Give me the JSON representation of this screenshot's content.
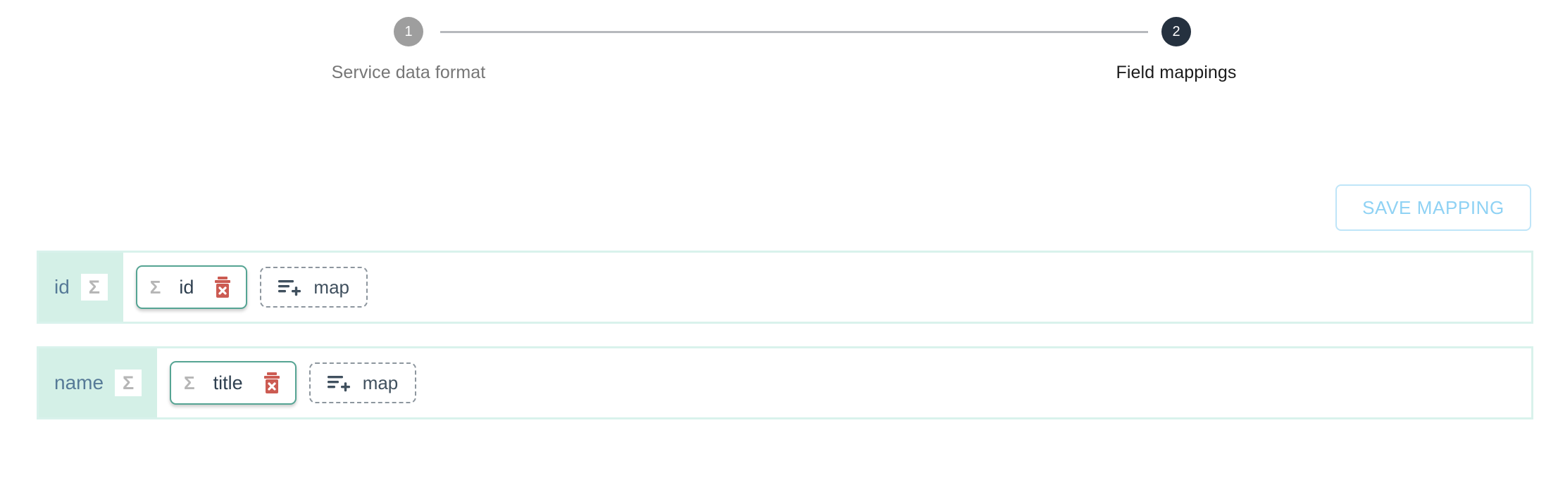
{
  "stepper": {
    "steps": [
      {
        "number": "1",
        "label": "Service data format",
        "state": "inactive"
      },
      {
        "number": "2",
        "label": "Field mappings",
        "state": "active"
      }
    ]
  },
  "toolbar": {
    "save_label": "SAVE MAPPING"
  },
  "mappings": {
    "rows": [
      {
        "source_field": "id",
        "source_badge_icon": "sigma-icon",
        "mapped": {
          "icon": "sigma-icon",
          "name": "id",
          "delete_icon": "trash-delete-icon"
        },
        "add_button": {
          "icon": "list-plus-icon",
          "label": "map"
        }
      },
      {
        "source_field": "name",
        "source_badge_icon": "sigma-icon",
        "mapped": {
          "icon": "sigma-icon",
          "name": "title",
          "delete_icon": "trash-delete-icon"
        },
        "add_button": {
          "icon": "list-plus-icon",
          "label": "map"
        }
      }
    ]
  },
  "colors": {
    "step_active": "#25313f",
    "step_inactive": "#9e9e9e",
    "row_border": "#d9f2ec",
    "row_label_bg": "#d4f0e7",
    "card_border": "#55a493",
    "save_button_text": "#8fd2f4",
    "delete_icon": "#cc5b52"
  },
  "glyphs": {
    "sigma": "Σ"
  }
}
